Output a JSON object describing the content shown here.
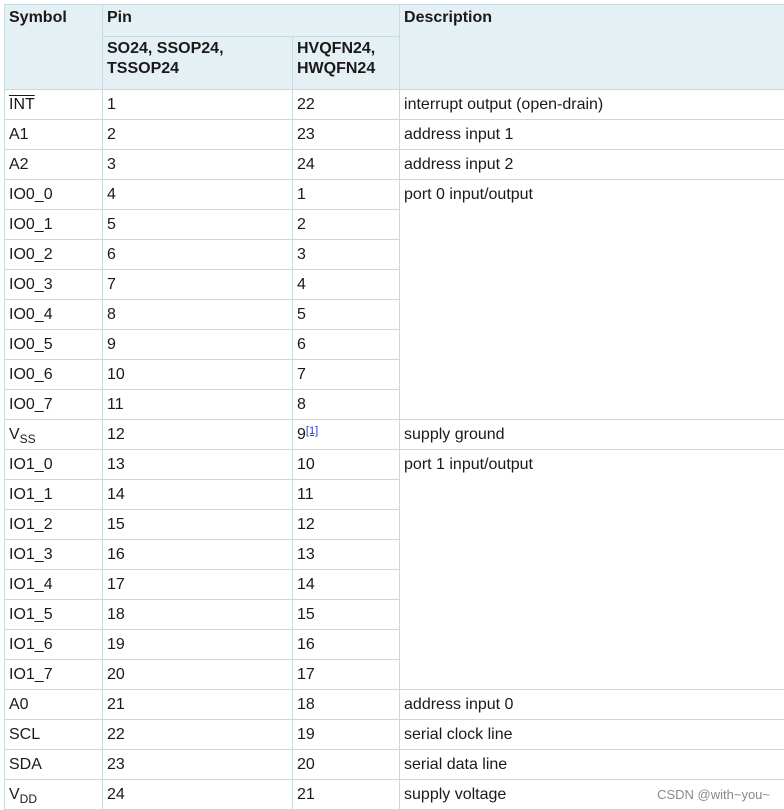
{
  "header": {
    "symbol": "Symbol",
    "pin": "Pin",
    "description": "Description",
    "pkg1": "SO24, SSOP24, TSSOP24",
    "pkg2": "HVQFN24, HWQFN24"
  },
  "rows": [
    {
      "symbol": "INT",
      "pin1": "1",
      "pin2": "22",
      "desc": "interrupt output (open-drain)"
    },
    {
      "symbol": "A1",
      "pin1": "2",
      "pin2": "23",
      "desc": "address input 1"
    },
    {
      "symbol": "A2",
      "pin1": "3",
      "pin2": "24",
      "desc": "address input 2"
    },
    {
      "symbol": "IO0_0",
      "pin1": "4",
      "pin2": "1",
      "desc": "port 0 input/output"
    },
    {
      "symbol": "IO0_1",
      "pin1": "5",
      "pin2": "2"
    },
    {
      "symbol": "IO0_2",
      "pin1": "6",
      "pin2": "3"
    },
    {
      "symbol": "IO0_3",
      "pin1": "7",
      "pin2": "4"
    },
    {
      "symbol": "IO0_4",
      "pin1": "8",
      "pin2": "5"
    },
    {
      "symbol": "IO0_5",
      "pin1": "9",
      "pin2": "6"
    },
    {
      "symbol": "IO0_6",
      "pin1": "10",
      "pin2": "7"
    },
    {
      "symbol": "IO0_7",
      "pin1": "11",
      "pin2": "8"
    },
    {
      "symbol_main": "V",
      "symbol_sub": "SS",
      "pin1": "12",
      "pin2": "9",
      "pin2_note": "[1]",
      "desc": "supply ground"
    },
    {
      "symbol": "IO1_0",
      "pin1": "13",
      "pin2": "10",
      "desc": "port 1 input/output"
    },
    {
      "symbol": "IO1_1",
      "pin1": "14",
      "pin2": "11"
    },
    {
      "symbol": "IO1_2",
      "pin1": "15",
      "pin2": "12"
    },
    {
      "symbol": "IO1_3",
      "pin1": "16",
      "pin2": "13"
    },
    {
      "symbol": "IO1_4",
      "pin1": "17",
      "pin2": "14"
    },
    {
      "symbol": "IO1_5",
      "pin1": "18",
      "pin2": "15"
    },
    {
      "symbol": "IO1_6",
      "pin1": "19",
      "pin2": "16"
    },
    {
      "symbol": "IO1_7",
      "pin1": "20",
      "pin2": "17"
    },
    {
      "symbol": "A0",
      "pin1": "21",
      "pin2": "18",
      "desc": "address input 0"
    },
    {
      "symbol": "SCL",
      "pin1": "22",
      "pin2": "19",
      "desc": "serial clock line"
    },
    {
      "symbol": "SDA",
      "pin1": "23",
      "pin2": "20",
      "desc": "serial data line"
    },
    {
      "symbol_main": "V",
      "symbol_sub": "DD",
      "pin1": "24",
      "pin2": "21",
      "desc": "supply voltage"
    }
  ],
  "watermark": "CSDN @with~you~"
}
